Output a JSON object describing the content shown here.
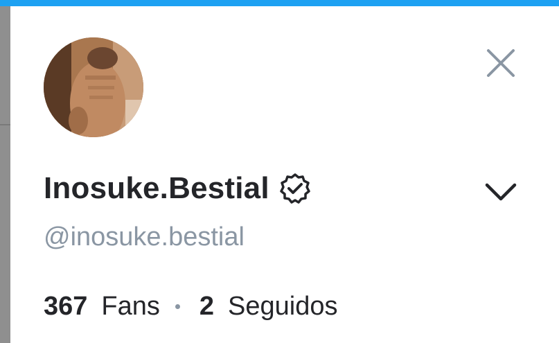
{
  "colors": {
    "accent": "#1da1f2",
    "text_primary": "#242529",
    "text_secondary": "#8a96a3",
    "icon": "#8a96a3"
  },
  "profile": {
    "display_name": "Inosuke.Bestial",
    "username": "@inosuke.bestial",
    "verified_icon": "verified-badge-icon",
    "avatar_icon": "avatar-photo"
  },
  "stats": {
    "fans_count": "367",
    "fans_label": "Fans",
    "following_count": "2",
    "following_label": "Seguidos"
  },
  "actions": {
    "close_icon": "close-icon",
    "expand_icon": "chevron-down-icon"
  }
}
